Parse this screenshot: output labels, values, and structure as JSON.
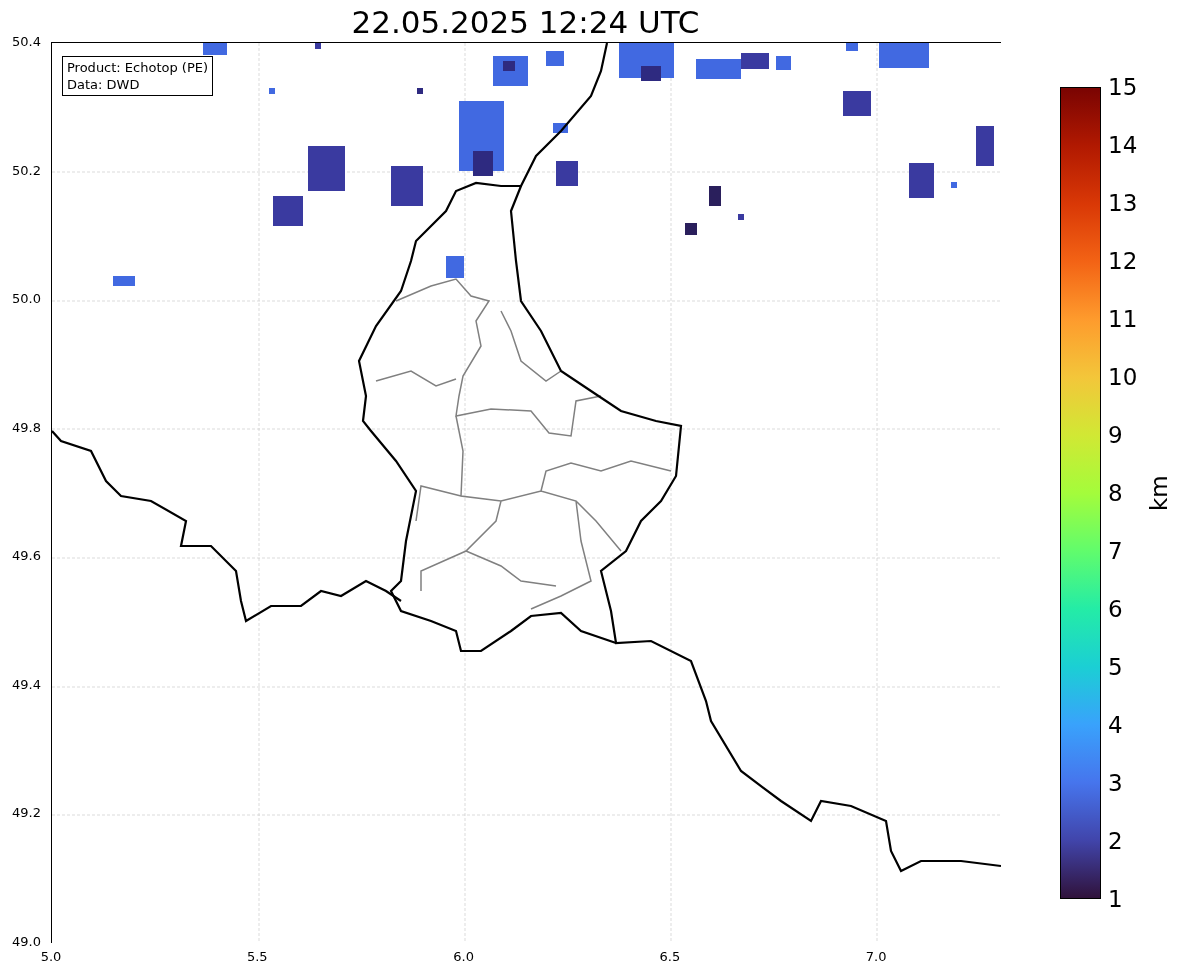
{
  "title": "22.05.2025 12:24 UTC",
  "legend_lines": [
    "Product: Echotop (PE)",
    "Data: DWD"
  ],
  "x_axis": {
    "ticks": [
      "5.0",
      "5.5",
      "6.0",
      "6.5",
      "7.0"
    ]
  },
  "y_axis": {
    "ticks": [
      "50.4",
      "50.2",
      "50.0",
      "49.8",
      "49.6",
      "49.4",
      "49.2",
      "49.0"
    ]
  },
  "colorbar": {
    "label": "km",
    "ticks": [
      "15",
      "14",
      "13",
      "12",
      "11",
      "10",
      "9",
      "8",
      "7",
      "6",
      "5",
      "4",
      "3",
      "2",
      "1"
    ]
  }
}
